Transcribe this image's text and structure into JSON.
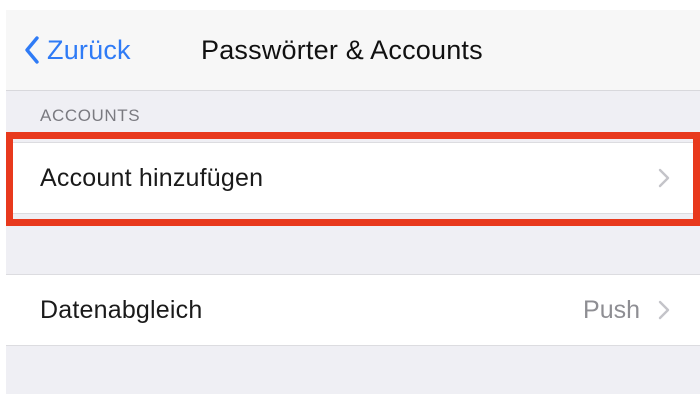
{
  "navbar": {
    "back_label": "Zurück",
    "title": "Passwörter & Accounts"
  },
  "sections": {
    "accounts_header": "ACCOUNTS"
  },
  "rows": {
    "add_account": {
      "label": "Account hinzufügen"
    },
    "data_sync": {
      "label": "Datenabgleich",
      "value": "Push"
    }
  },
  "colors": {
    "accent": "#2f7bf6",
    "highlight": "#e8391d",
    "background": "#efeff4"
  },
  "icons": {
    "back": "chevron-left-icon",
    "disclosure": "chevron-right-icon"
  }
}
